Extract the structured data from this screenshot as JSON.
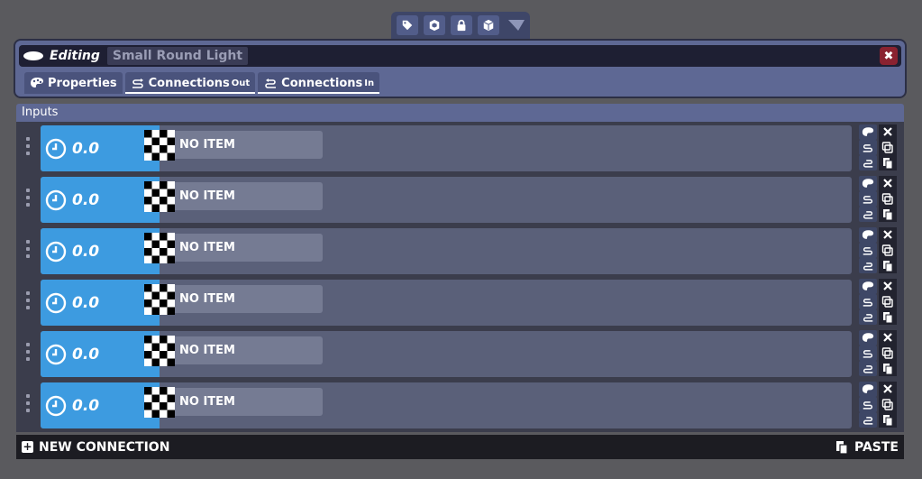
{
  "toolbar": {
    "icons": [
      "tag-icon",
      "box-cube-icon",
      "lock-icon",
      "cube-icon",
      "filter-arrow-icon"
    ]
  },
  "editor": {
    "editing_label": "Editing",
    "object_name": "Small Round Light",
    "close_label": "✖",
    "tabs": [
      {
        "label": "Properties",
        "suffix": "",
        "icon": "palette-icon"
      },
      {
        "label": "Connections",
        "suffix": "Out",
        "icon": "connection-out-icon"
      },
      {
        "label": "Connections",
        "suffix": "In",
        "icon": "connection-in-icon"
      }
    ]
  },
  "inputs": {
    "header": "Inputs",
    "rows": [
      {
        "time": "0.0",
        "item": "NO ITEM"
      },
      {
        "time": "0.0",
        "item": "NO ITEM"
      },
      {
        "time": "0.0",
        "item": "NO ITEM"
      },
      {
        "time": "0.0",
        "item": "NO ITEM"
      },
      {
        "time": "0.0",
        "item": "NO ITEM"
      },
      {
        "time": "0.0",
        "item": "NO ITEM"
      }
    ]
  },
  "footer": {
    "new_connection": "NEW CONNECTION",
    "paste": "PASTE"
  },
  "colors": {
    "accent_blue": "#3d9be0",
    "panel": "#5e6894",
    "close_red": "#8a2230"
  }
}
